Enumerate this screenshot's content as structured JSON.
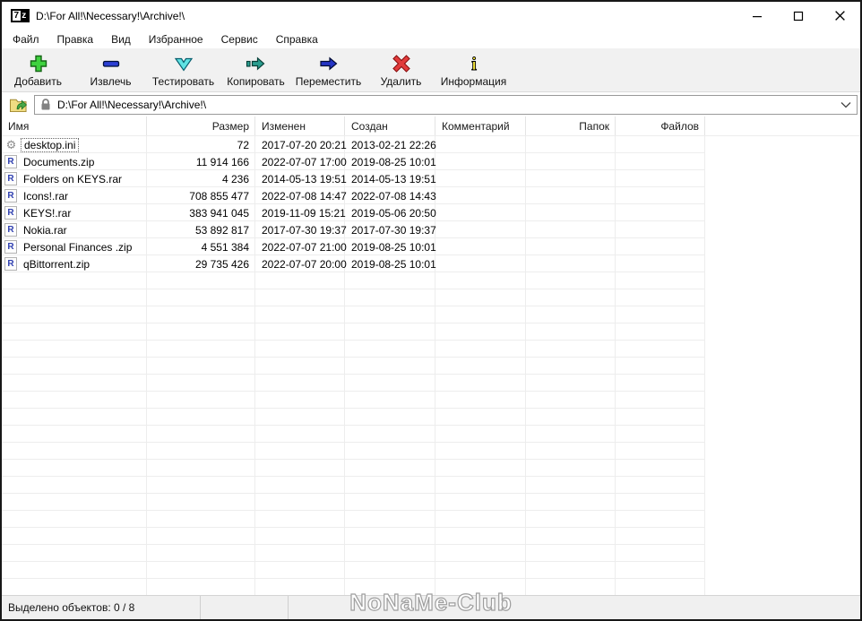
{
  "window": {
    "title": "D:\\For All!\\Necessary!\\Archive!\\",
    "app_icon_7": "7",
    "app_icon_z": "z",
    "controls": [
      "minimize",
      "maximize",
      "close"
    ]
  },
  "menu": {
    "items": [
      "Файл",
      "Правка",
      "Вид",
      "Избранное",
      "Сервис",
      "Справка"
    ]
  },
  "toolbar": {
    "buttons": [
      {
        "label": "Добавить",
        "icon": "add-plus-icon"
      },
      {
        "label": "Извлечь",
        "icon": "extract-minus-icon"
      },
      {
        "label": "Тестировать",
        "icon": "test-check-icon"
      },
      {
        "label": "Копировать",
        "icon": "copy-arrow-icon"
      },
      {
        "label": "Переместить",
        "icon": "move-arrow-icon"
      },
      {
        "label": "Удалить",
        "icon": "delete-x-icon"
      },
      {
        "label": "Информация",
        "icon": "info-icon"
      }
    ]
  },
  "address_bar": {
    "path": "D:\\For All!\\Necessary!\\Archive!\\",
    "up_icon": "folder-up-icon",
    "lock_icon": "lock-icon",
    "dropdown_icon": "chevron-down-icon"
  },
  "icons": {
    "rar_letter": "R",
    "gear_glyph": "⚙"
  },
  "list": {
    "columns": [
      {
        "label": "Имя",
        "align": "left"
      },
      {
        "label": "Размер",
        "align": "right"
      },
      {
        "label": "Изменен",
        "align": "left"
      },
      {
        "label": "Создан",
        "align": "left"
      },
      {
        "label": "Комментарий",
        "align": "left"
      },
      {
        "label": "Папок",
        "align": "right"
      },
      {
        "label": "Файлов",
        "align": "right"
      }
    ],
    "rows": [
      {
        "icon": "gear-file-icon",
        "name": "desktop.ini",
        "size": "72",
        "modified": "2017-07-20 20:21",
        "created": "2013-02-21 22:26"
      },
      {
        "icon": "rar-archive-icon",
        "name": "Documents.zip",
        "size": "11 914 166",
        "modified": "2022-07-07 17:00",
        "created": "2019-08-25 10:01"
      },
      {
        "icon": "rar-archive-icon",
        "name": "Folders on KEYS.rar",
        "size": "4 236",
        "modified": "2014-05-13 19:51",
        "created": "2014-05-13 19:51"
      },
      {
        "icon": "rar-archive-icon",
        "name": "Icons!.rar",
        "size": "708 855 477",
        "modified": "2022-07-08 14:47",
        "created": "2022-07-08 14:43"
      },
      {
        "icon": "rar-archive-icon",
        "name": "KEYS!.rar",
        "size": "383 941 045",
        "modified": "2019-11-09 15:21",
        "created": "2019-05-06 20:50"
      },
      {
        "icon": "rar-archive-icon",
        "name": "Nokia.rar",
        "size": "53 892 817",
        "modified": "2017-07-30 19:37",
        "created": "2017-07-30 19:37"
      },
      {
        "icon": "rar-archive-icon",
        "name": "Personal Finances .zip",
        "size": "4 551 384",
        "modified": "2022-07-07 21:00",
        "created": "2019-08-25 10:01"
      },
      {
        "icon": "rar-archive-icon",
        "name": "qBittorrent.zip",
        "size": "29 735 426",
        "modified": "2022-07-07 20:00",
        "created": "2019-08-25 10:01"
      }
    ]
  },
  "status_bar": {
    "selected_text": "Выделено объектов: 0 / 8"
  },
  "watermark": {
    "text": "NoNaMe-Club"
  }
}
